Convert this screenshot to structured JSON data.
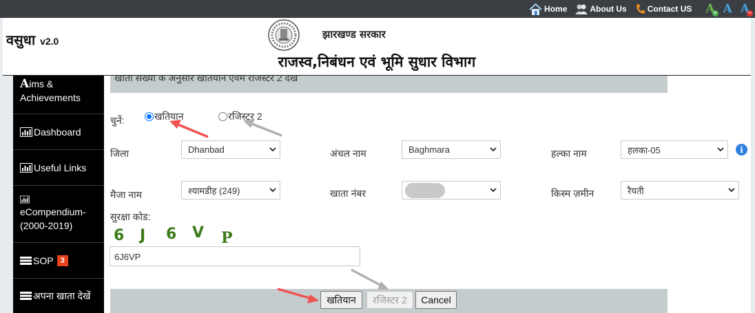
{
  "topnav": {
    "home": "Home",
    "about": "About Us",
    "contact": "Contact US",
    "font_buttons": [
      {
        "glyph": "A",
        "mark": "+",
        "icon": "font-increase-icon"
      },
      {
        "glyph": "A",
        "icon": "font-normal-icon"
      },
      {
        "glyph": "A",
        "mark": "−",
        "icon": "font-decrease-icon"
      }
    ]
  },
  "header": {
    "brand": "वसुधा",
    "version": "v2.0",
    "gov_name": "झारखण्ड सरकार",
    "dept_name": "राजस्व,निबंधन एवं भूमि सुधार विभाग"
  },
  "sidebar": {
    "items": [
      {
        "lead": "A",
        "label": "ims & Achievements",
        "icon": "aims-icon"
      },
      {
        "label": "Dashboard",
        "icon": "chart-icon"
      },
      {
        "label": "Useful Links",
        "icon": "chart-icon"
      },
      {
        "label": "eCompendium-(2000-2019)",
        "icon": "chart-icon"
      },
      {
        "label": "SOP",
        "badge": "3",
        "icon": "list-icon"
      },
      {
        "label": "अपना खाता देखें",
        "icon": "list-icon"
      }
    ]
  },
  "form": {
    "section_title": "खाता संख्या के अनुसार खतियान एवम रजिस्टर 2 देखें",
    "choose_label": "चुनें:",
    "radio_options": [
      "खतियान",
      "रजिस्टर 2"
    ],
    "selected_radio": "खतियान",
    "district": {
      "label": "जिला",
      "value": "Dhanbad"
    },
    "circle": {
      "label": "अंचल नाम",
      "value": "Baghmara"
    },
    "halka": {
      "label": "हल्का नाम",
      "value": "हलका-05"
    },
    "mauza": {
      "label": "मैजा नाम",
      "value": "श्यामडीह (249)"
    },
    "khata": {
      "label": "खाता नंबर",
      "value": ""
    },
    "land_type": {
      "label": "किस्म ज़मीन",
      "value": "रैयती"
    },
    "security_label": "सुरक्षा कोड:",
    "captcha_chars": [
      "6",
      "J",
      "6",
      "V",
      "P"
    ],
    "captcha_input": "6J6VP",
    "buttons": {
      "khatiyan": "खतियान",
      "register2": "रजिस्टर 2",
      "cancel": "Cancel"
    }
  },
  "colors": {
    "topbar": "#3b3f44",
    "sidebar": "#000000",
    "panel_bar": "#c5ccce",
    "captcha": "#3d7a1a",
    "badge": "#e8431c",
    "red_arrow": "#ef5350",
    "grey_arrow": "#b0b0b0"
  }
}
